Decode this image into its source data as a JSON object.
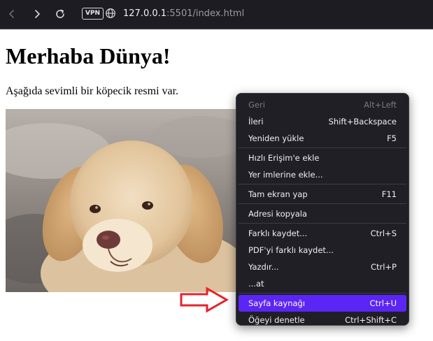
{
  "browser": {
    "vpn_label": "VPN",
    "url_host": "127.0.0.1",
    "url_rest": ":5501/index.html"
  },
  "page": {
    "title": "Merhaba Dünya!",
    "text": "Aşağıda sevimli bir köpecik resmi var."
  },
  "context_menu": {
    "groups": [
      [
        {
          "label": "Geri",
          "shortcut": "Alt+Left",
          "disabled": true
        },
        {
          "label": "İleri",
          "shortcut": "Shift+Backspace"
        },
        {
          "label": "Yeniden yükle",
          "shortcut": "F5"
        }
      ],
      [
        {
          "label": "Hızlı Erişim'e ekle",
          "shortcut": ""
        },
        {
          "label": "Yer imlerine ekle...",
          "shortcut": ""
        }
      ],
      [
        {
          "label": "Tam ekran yap",
          "shortcut": "F11"
        }
      ],
      [
        {
          "label": "Adresi kopyala",
          "shortcut": ""
        }
      ],
      [
        {
          "label": "Farklı kaydet...",
          "shortcut": "Ctrl+S"
        },
        {
          "label": "PDF'yi farklı kaydet...",
          "shortcut": ""
        },
        {
          "label": "Yazdır...",
          "shortcut": "Ctrl+P"
        },
        {
          "label": "...at",
          "shortcut": ""
        }
      ],
      [
        {
          "label": "Sayfa kaynağı",
          "shortcut": "Ctrl+U",
          "highlighted": true
        },
        {
          "label": "Öğeyi denetle",
          "shortcut": "Ctrl+Shift+C"
        }
      ]
    ]
  },
  "colors": {
    "toolbar_bg": "#1c1c22",
    "menu_bg": "#1f1f25",
    "menu_highlight": "#5b25f5",
    "arrow": "#e8232a"
  }
}
